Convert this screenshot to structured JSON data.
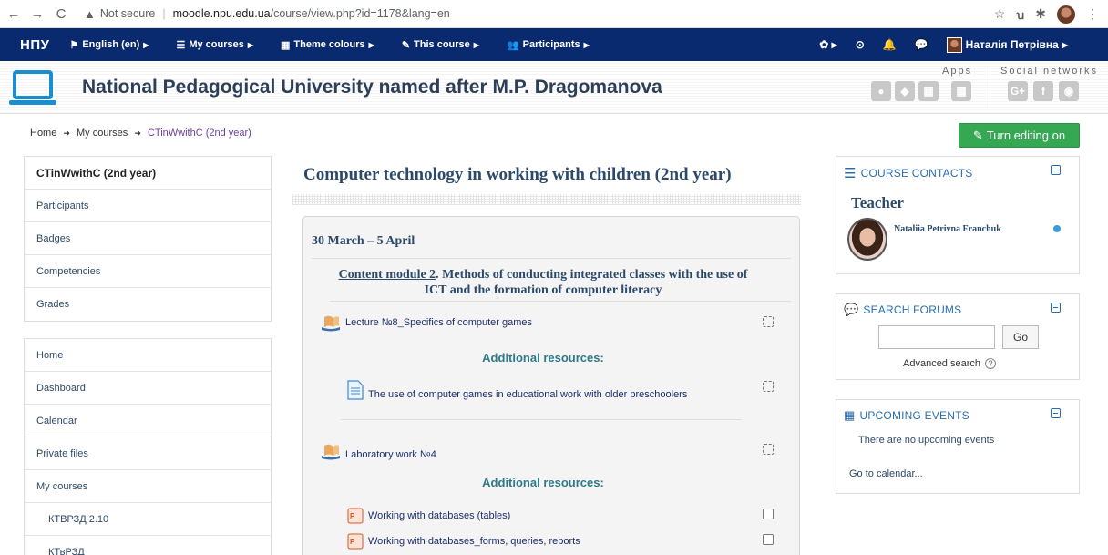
{
  "browser": {
    "security": "Not secure",
    "url_host": "moodle.npu.edu.ua",
    "url_path": "/course/view.php?id=1178&lang=en",
    "ext_label": "ꭒ"
  },
  "navbar": {
    "brand": "НПУ",
    "items": [
      {
        "label": "English (en)"
      },
      {
        "label": "My courses"
      },
      {
        "label": "Theme colours"
      },
      {
        "label": "This course"
      },
      {
        "label": "Participants"
      }
    ],
    "user_name": "Наталія Петрівна"
  },
  "header": {
    "site_title": "National Pedagogical University named after M.P. Dragomanova",
    "apps_label": "Apps",
    "social_label": "Social networks",
    "social_icons": [
      "G+",
      "f",
      "◉"
    ]
  },
  "breadcrumb": {
    "home": "Home",
    "my_courses": "My courses",
    "course": "CTinWwithC (2nd year)"
  },
  "edit_button": "Turn editing on",
  "left_nav1": {
    "title": "CTinWwithC (2nd year)",
    "items": [
      "Participants",
      "Badges",
      "Competencies",
      "Grades"
    ]
  },
  "left_nav2": {
    "items": [
      "Home",
      "Dashboard",
      "Calendar",
      "Private files",
      "My courses"
    ],
    "sub_items": [
      "КТВРЗД 2.10",
      "КТвРЗД"
    ]
  },
  "main": {
    "course_title": "Computer technology in working with children (2nd year)",
    "section_title": "30 March – 5 April",
    "module_link": "Content module 2",
    "module_rest": ". Methods of conducting integrated classes with the use of",
    "module_line2": "ICT and the formation of computer literacy",
    "lecture": "Lecture №8_Specifics of computer games",
    "additional_1": "Additional resources:",
    "resource_1": "The use of computer games in educational work with older preschoolers",
    "lab": "Laboratory work №4",
    "additional_2": "Additional resources:",
    "resource_2": "Working with databases (tables)",
    "resource_3": "Working with databases_forms, queries, reports"
  },
  "contacts": {
    "title": "COURSE CONTACTS",
    "role": "Teacher",
    "name": "Nataliia Petrivna Franchuk"
  },
  "search_forums": {
    "title": "SEARCH FORUMS",
    "go": "Go",
    "advanced": "Advanced search",
    "input_value": ""
  },
  "events": {
    "title": "UPCOMING EVENTS",
    "none": "There are no upcoming events",
    "goto": "Go to calendar..."
  },
  "colors": {
    "navbar": "#0a2a6f",
    "edit_button": "#34a853",
    "link_blue": "#2a6db0"
  }
}
